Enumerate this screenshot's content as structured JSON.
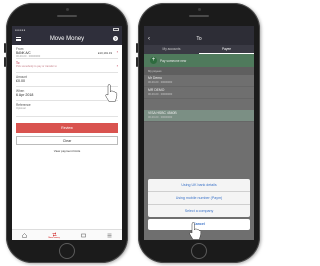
{
  "left_screen": {
    "title": "Move Money",
    "from": {
      "label": "From",
      "account_name": "BANK A/C",
      "account_number": "00-00-00 · 00000000",
      "balance": "£10,191.19"
    },
    "to": {
      "label": "To",
      "placeholder": "Pick somebody to pay or transfer to"
    },
    "amount": {
      "label": "Amount",
      "value": "£0.00"
    },
    "when": {
      "label": "When",
      "value": "6 Apr 2018"
    },
    "reference": {
      "label": "Reference",
      "placeholder": "Optional"
    },
    "review_button": "Review",
    "clear_button": "Clear",
    "limits_link": "View payment limits",
    "tabs": [
      {
        "icon": "home-icon"
      },
      {
        "icon": "move-money-icon",
        "label": "Move money"
      },
      {
        "icon": "cards-icon"
      },
      {
        "icon": "more-icon"
      }
    ]
  },
  "right_screen": {
    "title": "To",
    "tabs": [
      "My accounts",
      "Payee"
    ],
    "add_payee_label": "Pay someone new",
    "section_header": "My payees",
    "payees": [
      {
        "name": "Mr Demo",
        "detail": "00-00-00 · 00000000"
      },
      {
        "name": "MR DEMO",
        "detail": "00-00-00 · 00000000"
      },
      {
        "name": "VISA   HSBC 4540B",
        "detail": "00-00-00 · 00000000"
      }
    ],
    "options": [
      "Using UK bank details",
      "Using mobile number (Paym)",
      "Select a company"
    ],
    "cancel": "Cancel"
  },
  "colors": {
    "header": "#2f2f3b",
    "accent_red": "#d9534f",
    "link_blue": "#3b73c9",
    "add_payee_green": "#2e6b3e"
  }
}
